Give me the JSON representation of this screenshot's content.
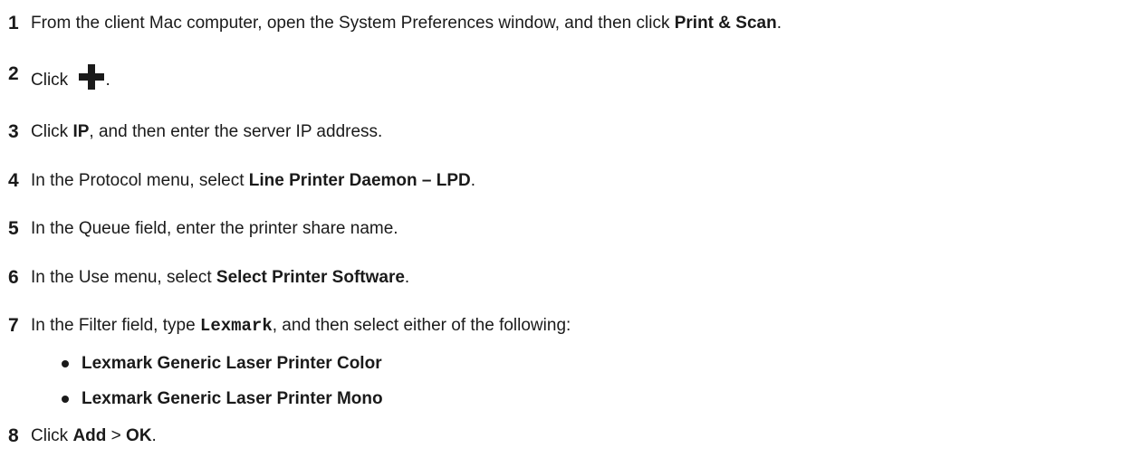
{
  "steps": [
    {
      "n": "1",
      "a": "From the client Mac computer, open the System Preferences window, and then click ",
      "b": "Print & Scan",
      "c": "."
    },
    {
      "n": "2",
      "a": "Click ",
      "c": "."
    },
    {
      "n": "3",
      "a": "Click ",
      "b": "IP",
      "c": ", and then enter the server IP address."
    },
    {
      "n": "4",
      "a": "In the Protocol menu, select ",
      "b": "Line Printer Daemon – LPD",
      "c": "."
    },
    {
      "n": "5",
      "a": "In the Queue field, enter the printer share name."
    },
    {
      "n": "6",
      "a": "In the Use menu, select ",
      "b": "Select Printer Software",
      "c": "."
    },
    {
      "n": "7",
      "a": "In the Filter field, type ",
      "code": "Lexmark",
      "c": ", and then select either of the following:"
    },
    {
      "n": "8",
      "a": "Click ",
      "b": "Add",
      "mid": " > ",
      "b2": "OK",
      "c": "."
    }
  ],
  "bullets": [
    "Lexmark Generic Laser Printer Color",
    "Lexmark Generic Laser Printer Mono"
  ],
  "icons": {
    "add": "plus-icon"
  }
}
